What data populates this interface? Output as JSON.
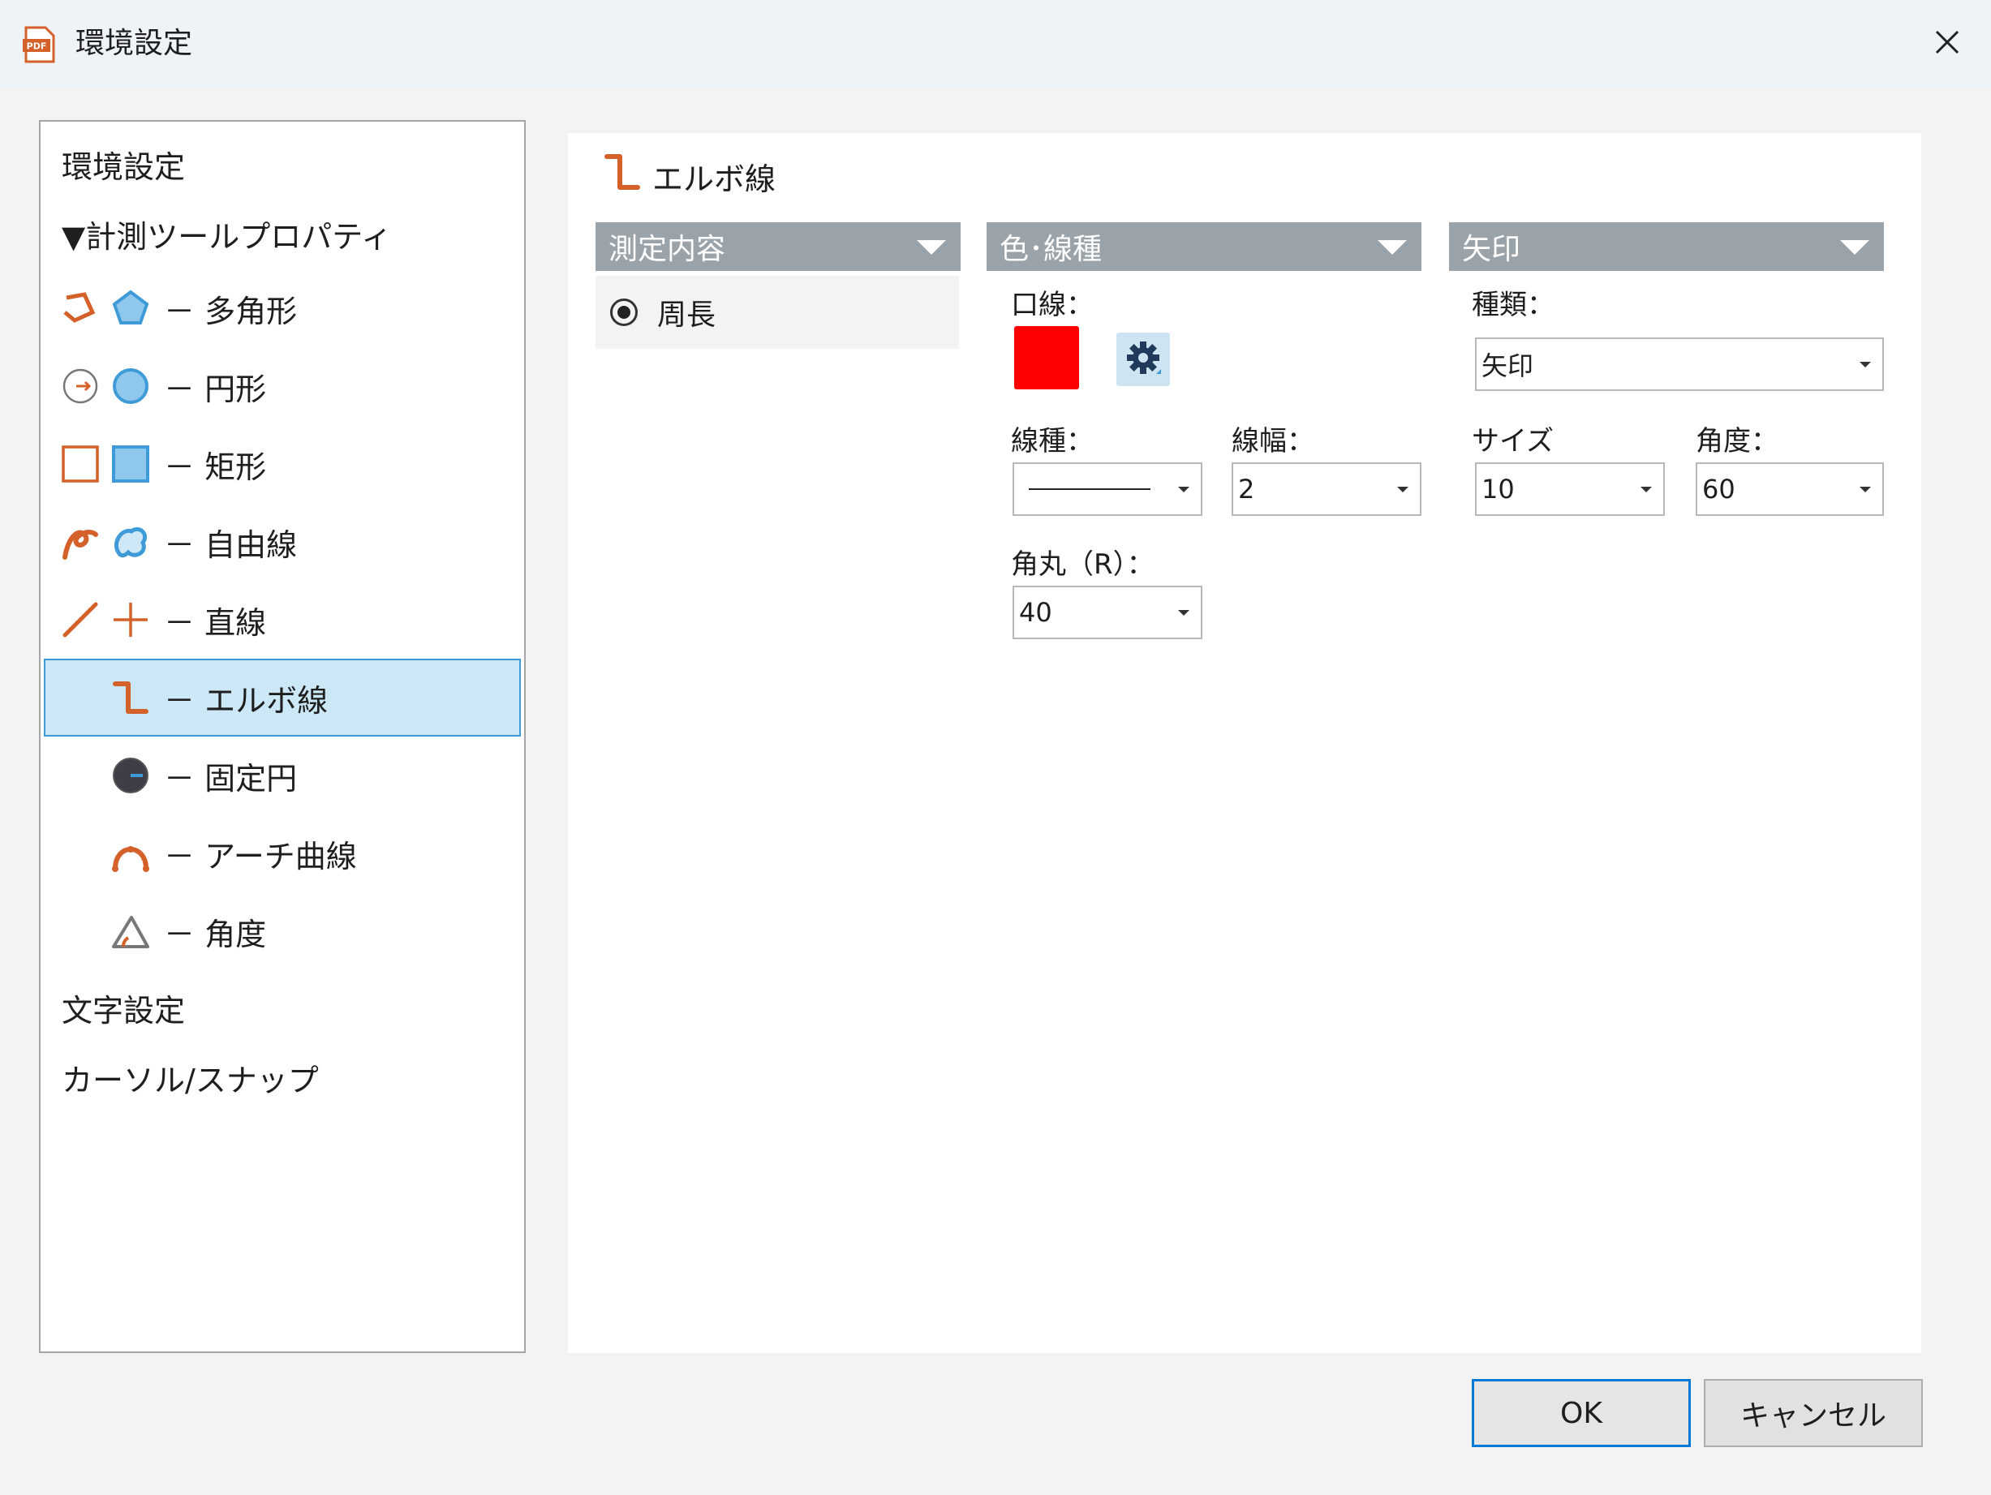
{
  "window": {
    "title": "環境設定",
    "app_icon": "pdf-icon",
    "close_icon": "close-icon"
  },
  "tree": {
    "items": [
      {
        "label": "環境設定",
        "icons": []
      },
      {
        "label": "▼計測ツールプロパティ",
        "icons": []
      },
      {
        "label": "－ 多角形",
        "icons": [
          "polygon-measure-icon",
          "polygon-area-icon"
        ]
      },
      {
        "label": "－ 円形",
        "icons": [
          "circle-measure-icon",
          "circle-area-icon"
        ]
      },
      {
        "label": "－ 矩形",
        "icons": [
          "rectangle-measure-icon",
          "rectangle-area-icon"
        ]
      },
      {
        "label": "－ 自由線",
        "icons": [
          "freehand-measure-icon",
          "freehand-area-icon"
        ]
      },
      {
        "label": "－ 直線",
        "icons": [
          "line-measure-icon",
          "crosshair-icon"
        ]
      },
      {
        "label": "－ エルボ線",
        "icons": [
          "elbow-line-icon"
        ],
        "selected": true
      },
      {
        "label": "－ 固定円",
        "icons": [
          "fixed-circle-icon"
        ]
      },
      {
        "label": "－ アーチ曲線",
        "icons": [
          "arch-curve-icon"
        ]
      },
      {
        "label": "－ 角度",
        "icons": [
          "angle-icon"
        ]
      },
      {
        "label": "文字設定",
        "icons": []
      },
      {
        "label": "カーソル/スナップ",
        "icons": []
      }
    ]
  },
  "panel": {
    "title": "エルボ線",
    "sections": {
      "measure": {
        "label": "測定内容"
      },
      "color": {
        "label": "色･線種"
      },
      "arrow": {
        "label": "矢印"
      }
    },
    "measure_option": {
      "label": "周長",
      "selected": true
    },
    "color": {
      "line_label": "口線：",
      "line_color": "#ff0000",
      "line_type_label": "線種：",
      "line_type_value": "solid",
      "line_width_label": "線幅：",
      "line_width_value": "2",
      "corner_label": "角丸（R）：",
      "corner_value": "40"
    },
    "arrow": {
      "type_label": "種類：",
      "type_value": "矢印",
      "size_label": "サイズ",
      "size_value": "10",
      "angle_label": "角度：",
      "angle_value": "60"
    }
  },
  "buttons": {
    "ok": "OK",
    "cancel": "キャンセル"
  },
  "colors": {
    "accent": "#3f9bd8",
    "icon_orange": "#d4602a",
    "icon_blue": "#3f9bd8",
    "section_header": "#9aa3aa"
  }
}
